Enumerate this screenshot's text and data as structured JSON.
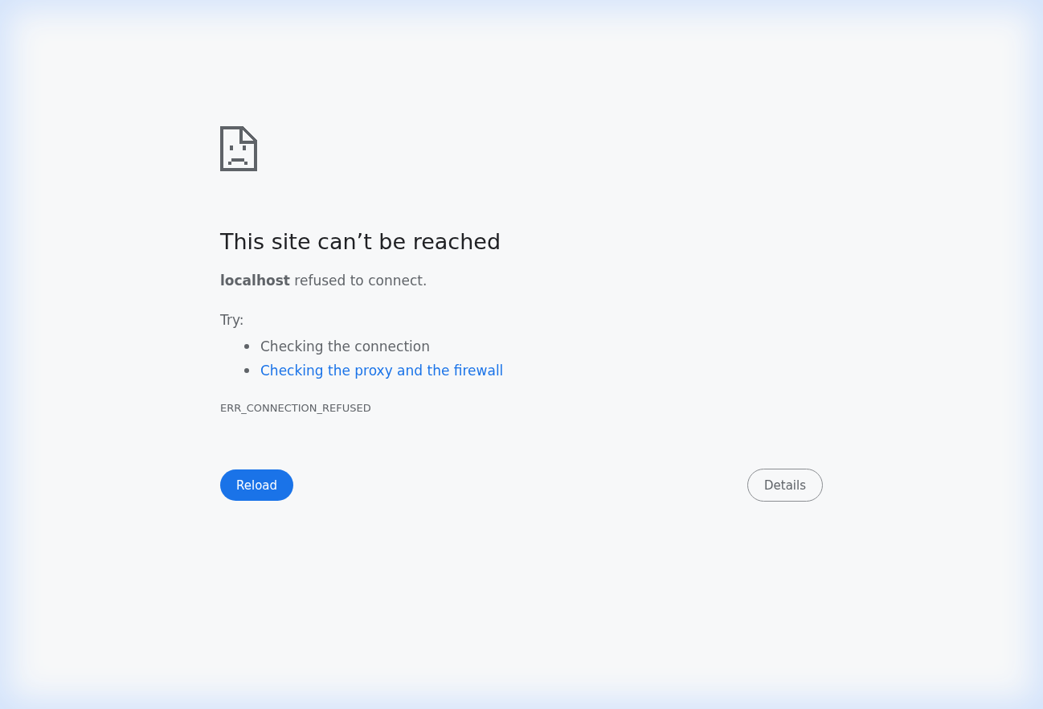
{
  "heading": "This site can’t be reached",
  "message": "**localhost** refused to connect.",
  "try_label": "Try:",
  "suggestions": [
    {
      "text": "Checking the connection",
      "kind": "text"
    },
    {
      "text": "Checking the proxy and the firewall",
      "kind": "link"
    }
  ],
  "error_code": "ERR_CONNECTION_REFUSED",
  "buttons": {
    "reload": "Reload",
    "details": "Details"
  }
}
